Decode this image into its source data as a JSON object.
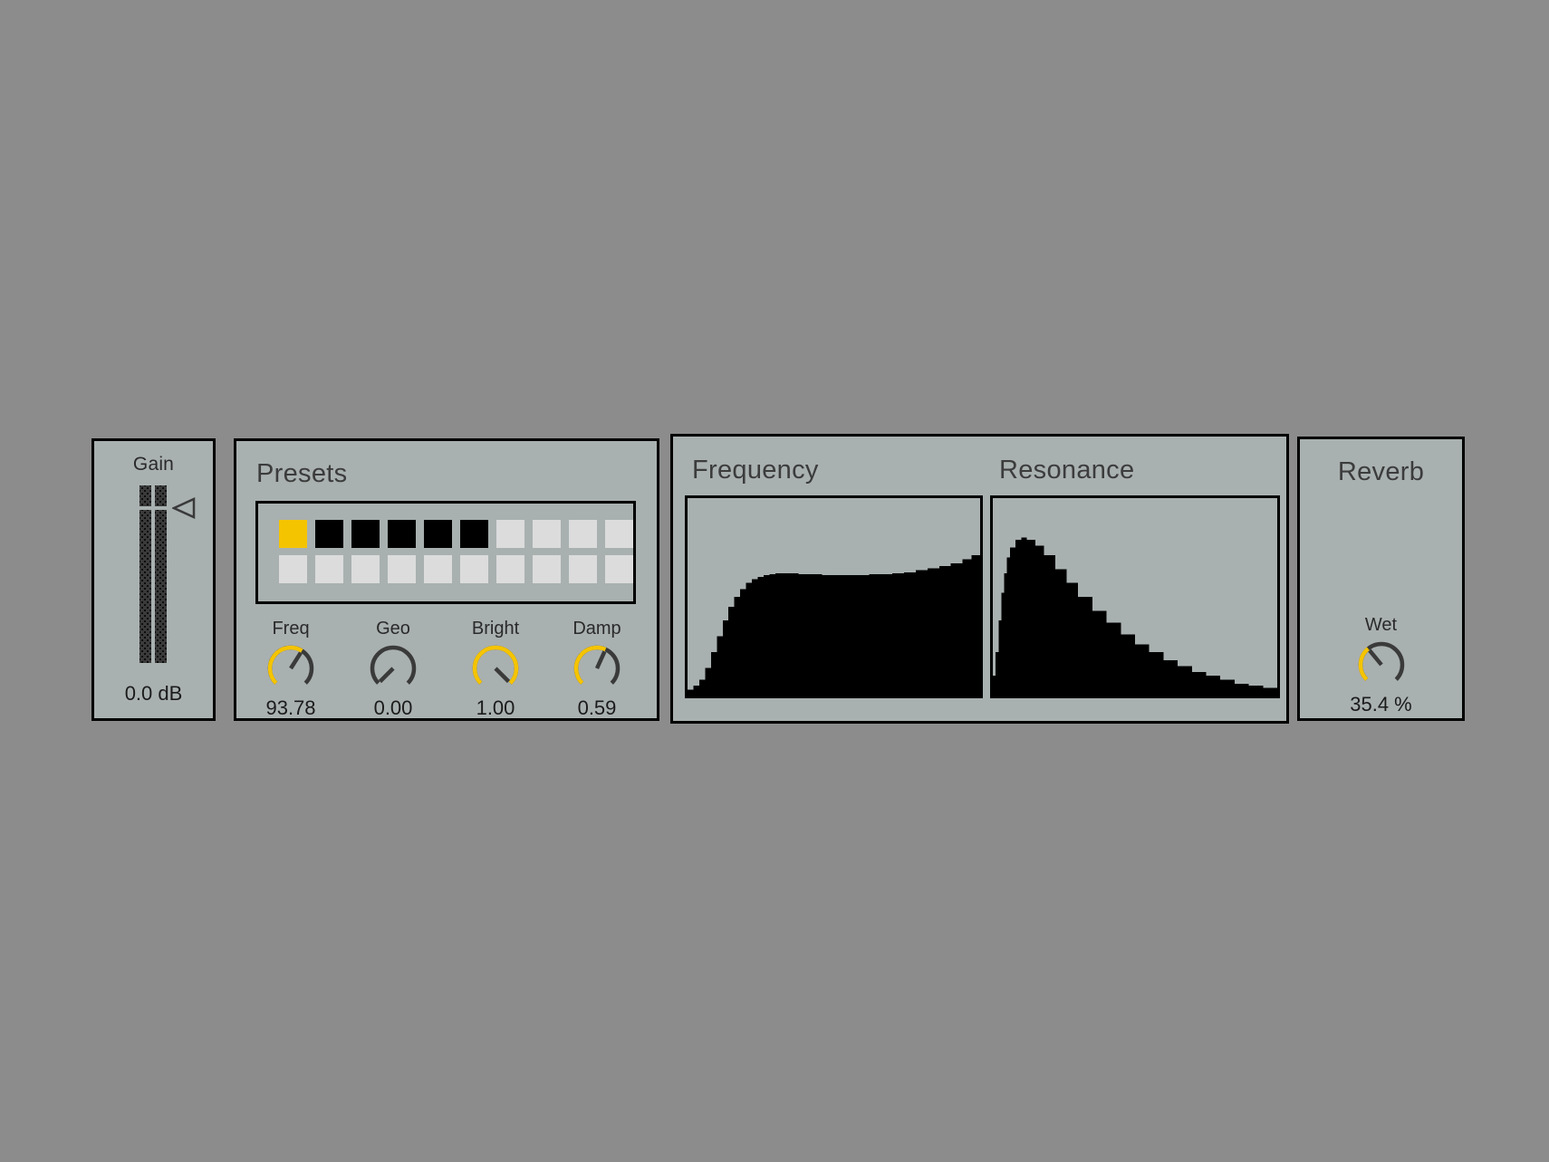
{
  "theme": {
    "background": "#8c8c8c",
    "panel_fill": "#a9b0b0",
    "border": "#000000",
    "accent_yellow": "#f5c400",
    "knob_track": "#3a3a3a",
    "cell_empty": "#dcdcdc",
    "cell_filled": "#000000",
    "graph_fill": "#000000",
    "text": "#2a2a2a"
  },
  "gain": {
    "label": "Gain",
    "value": "0.0 dB",
    "pointer_icon": "triangle-pointer-icon",
    "meter_position_pct": 12
  },
  "presets": {
    "title": "Presets",
    "columns": 10,
    "rows": 2,
    "cells": [
      [
        "selected",
        "filled",
        "filled",
        "filled",
        "filled",
        "filled",
        "empty",
        "empty",
        "empty",
        "empty"
      ],
      [
        "empty",
        "empty",
        "empty",
        "empty",
        "empty",
        "empty",
        "empty",
        "empty",
        "empty",
        "empty"
      ]
    ],
    "selected_index": 0,
    "knobs": [
      {
        "name": "freq",
        "label": "Freq",
        "value": "93.78",
        "fraction": 0.62,
        "active": true
      },
      {
        "name": "geo",
        "label": "Geo",
        "value": "0.00",
        "fraction": 0.0,
        "active": false
      },
      {
        "name": "bright",
        "label": "Bright",
        "value": "1.00",
        "fraction": 1.0,
        "active": true
      },
      {
        "name": "damp",
        "label": "Damp",
        "value": "0.59",
        "fraction": 0.59,
        "active": true
      }
    ]
  },
  "graphs": {
    "frequency": {
      "title": "Frequency"
    },
    "resonance": {
      "title": "Resonance"
    }
  },
  "reverb": {
    "title": "Reverb",
    "knob": {
      "name": "wet",
      "label": "Wet",
      "value": "35.4 %",
      "fraction": 0.354,
      "active": true
    }
  },
  "chart_data": [
    {
      "type": "area",
      "title": "Frequency",
      "xlabel": "",
      "ylabel": "",
      "xlim": [
        0,
        1
      ],
      "ylim": [
        0,
        1
      ],
      "grid": false,
      "legend": "none",
      "x": [
        0.0,
        0.02,
        0.04,
        0.06,
        0.08,
        0.1,
        0.12,
        0.14,
        0.16,
        0.18,
        0.2,
        0.22,
        0.24,
        0.26,
        0.28,
        0.3,
        0.34,
        0.38,
        0.42,
        0.46,
        0.5,
        0.54,
        0.58,
        0.62,
        0.66,
        0.7,
        0.74,
        0.78,
        0.82,
        0.86,
        0.9,
        0.94,
        0.97,
        1.0
      ],
      "y": [
        0.03,
        0.05,
        0.08,
        0.14,
        0.22,
        0.3,
        0.38,
        0.45,
        0.5,
        0.54,
        0.57,
        0.59,
        0.6,
        0.61,
        0.615,
        0.62,
        0.62,
        0.615,
        0.615,
        0.61,
        0.61,
        0.61,
        0.61,
        0.615,
        0.615,
        0.62,
        0.625,
        0.635,
        0.645,
        0.655,
        0.67,
        0.69,
        0.71,
        0.72
      ]
    },
    {
      "type": "area",
      "title": "Resonance",
      "xlabel": "",
      "ylabel": "",
      "xlim": [
        0,
        1
      ],
      "ylim": [
        0,
        1
      ],
      "grid": false,
      "legend": "none",
      "x": [
        0.0,
        0.01,
        0.02,
        0.03,
        0.04,
        0.05,
        0.06,
        0.08,
        0.1,
        0.12,
        0.15,
        0.18,
        0.22,
        0.26,
        0.3,
        0.35,
        0.4,
        0.45,
        0.5,
        0.55,
        0.6,
        0.65,
        0.7,
        0.75,
        0.8,
        0.85,
        0.9,
        0.95,
        1.0
      ],
      "y": [
        0.1,
        0.22,
        0.38,
        0.52,
        0.62,
        0.7,
        0.75,
        0.79,
        0.8,
        0.79,
        0.76,
        0.71,
        0.64,
        0.57,
        0.5,
        0.43,
        0.37,
        0.31,
        0.26,
        0.22,
        0.18,
        0.15,
        0.12,
        0.1,
        0.08,
        0.06,
        0.05,
        0.04,
        0.03
      ]
    }
  ]
}
